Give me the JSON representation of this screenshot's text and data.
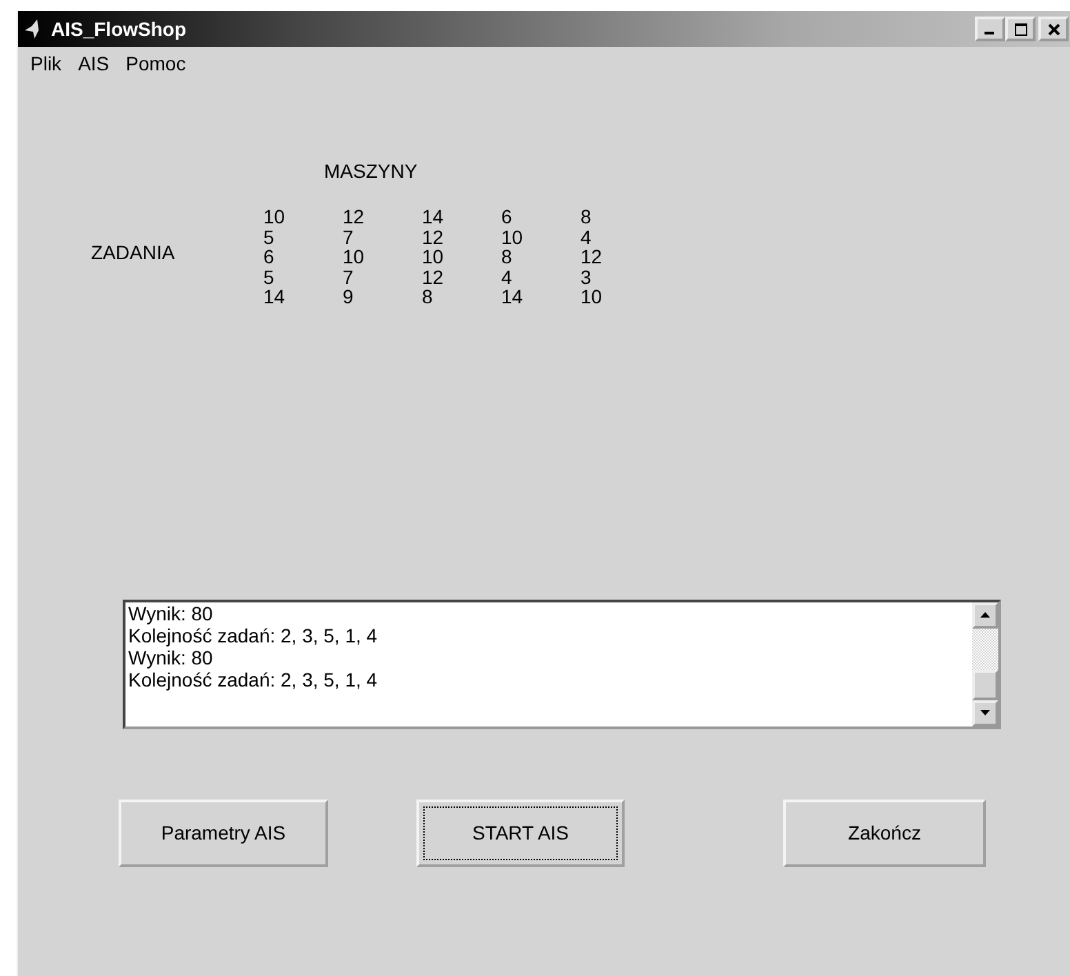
{
  "window": {
    "title": "AIS_FlowShop"
  },
  "menu": [
    "Plik",
    "AIS",
    "Pomoc"
  ],
  "matrix": {
    "column_heading": "MASZYNY",
    "row_heading": "ZADANIA",
    "rows": [
      [
        "10",
        "12",
        "14",
        "6",
        "8"
      ],
      [
        "5",
        "7",
        "12",
        "10",
        "4"
      ],
      [
        "6",
        "10",
        "10",
        "8",
        "12"
      ],
      [
        "5",
        "7",
        "12",
        "4",
        "3"
      ],
      [
        "14",
        "9",
        "8",
        "14",
        "10"
      ]
    ]
  },
  "output": {
    "lines": [
      "Wynik: 80",
      "Kolejność zadań: 2, 3, 5, 1, 4",
      "Wynik: 80",
      "Kolejność zadań: 2, 3, 5, 1, 4"
    ]
  },
  "buttons": [
    {
      "label": "Parametry AIS",
      "focused": false
    },
    {
      "label": "START AIS",
      "focused": true
    },
    {
      "label": "Zakończ",
      "focused": false
    }
  ]
}
